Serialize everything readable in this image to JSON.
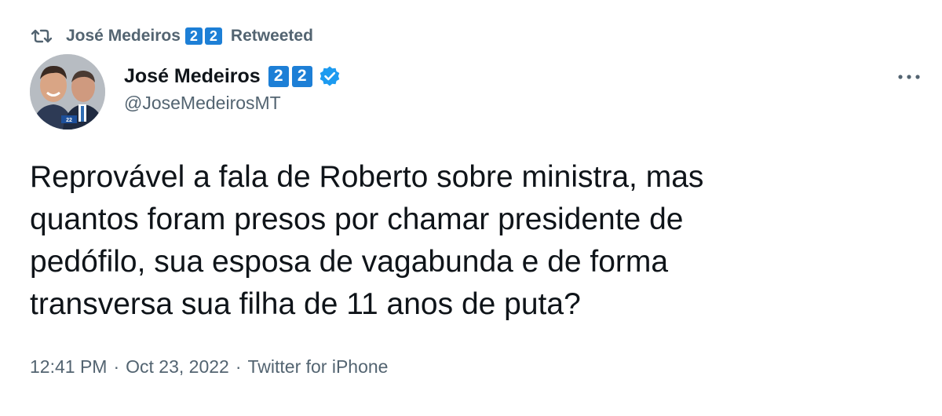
{
  "retweet": {
    "name": "José Medeiros",
    "badges": [
      "2",
      "2"
    ],
    "label": "Retweeted"
  },
  "author": {
    "display_name": "José Medeiros",
    "badges": [
      "2",
      "2"
    ],
    "handle": "@JoseMedeirosMT",
    "verified": true
  },
  "tweet": {
    "lines": [
      "Reprovável a fala de Roberto sobre ministra, mas",
      "quantos foram presos por chamar presidente de",
      "pedófilo, sua esposa de vagabunda e de forma",
      "transversa sua filha de 11 anos de puta?"
    ]
  },
  "meta": {
    "time": "12:41 PM",
    "separator": "·",
    "date": "Oct 23, 2022",
    "source": "Twitter for iPhone"
  },
  "colors": {
    "text": "#0f1419",
    "secondary": "#536471",
    "badge": "#1d7fd6",
    "verified": "#1d9bf0"
  },
  "icons": {
    "retweet": "retweet-icon",
    "verified": "verified-badge-icon",
    "more": "more-dots-icon"
  }
}
